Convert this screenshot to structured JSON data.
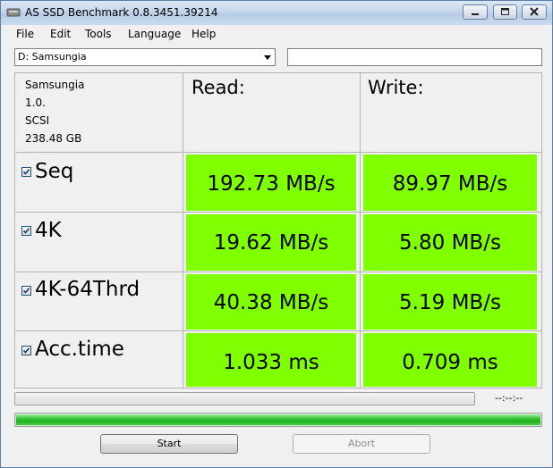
{
  "window": {
    "title": "AS SSD Benchmark 0.8.3451.39214"
  },
  "menu": [
    "File",
    "Edit",
    "Tools",
    "Language",
    "Help"
  ],
  "drive": {
    "selected": "D: Samsungia",
    "path_value": ""
  },
  "device_info": [
    "Samsungia",
    "1.0.",
    "SCSI",
    "238.48 GB"
  ],
  "columns": {
    "read": "Read:",
    "write": "Write:"
  },
  "rows": [
    {
      "label": "Seq",
      "checked": true,
      "read": "192.73 MB/s",
      "write": "89.97 MB/s"
    },
    {
      "label": "4K",
      "checked": true,
      "read": "19.62 MB/s",
      "write": "5.80 MB/s"
    },
    {
      "label": "4K-64Thrd",
      "checked": true,
      "read": "40.38 MB/s",
      "write": "5.19 MB/s"
    },
    {
      "label": "Acc.time",
      "checked": true,
      "read": "1.033 ms",
      "write": "0.709 ms"
    }
  ],
  "progress": {
    "test_fraction": 0,
    "overall_fraction": 1,
    "time_text": "--:--:--"
  },
  "buttons": {
    "start": "Start",
    "abort": "Abort"
  },
  "colors": {
    "result_cell": "#80ff00",
    "progress_fill": "#22b022"
  },
  "icons": {
    "app": "disk-icon",
    "minimize": "minimize-icon",
    "maximize": "maximize-icon",
    "close": "close-icon",
    "dropdown": "chevron-down-icon",
    "checkbox": "checkmark-icon"
  }
}
